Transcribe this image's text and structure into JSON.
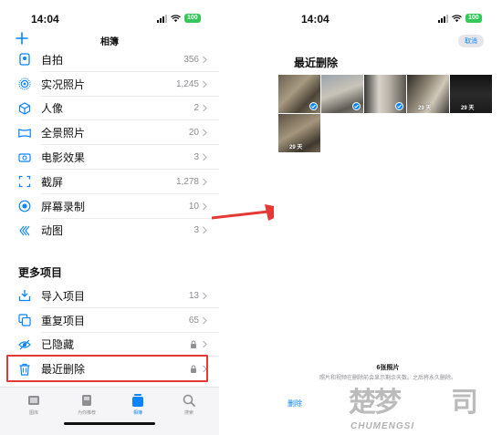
{
  "colors": {
    "accent": "#0a84ff",
    "highlight": "#e53935",
    "arrow": "#e53935",
    "battery": "#34c759"
  },
  "left": {
    "status": {
      "time": "14:04",
      "battery": "100"
    },
    "header": {
      "add_icon": "plus-icon",
      "title": "相簿"
    },
    "media_types": [
      {
        "label": "自拍",
        "count": "356",
        "icon": "selfie-icon"
      },
      {
        "label": "实况照片",
        "count": "1,245",
        "icon": "live-photo-icon"
      },
      {
        "label": "人像",
        "count": "2",
        "icon": "portrait-cube-icon"
      },
      {
        "label": "全景照片",
        "count": "20",
        "icon": "panorama-icon"
      },
      {
        "label": "电影效果",
        "count": "3",
        "icon": "cinematic-icon"
      },
      {
        "label": "截屏",
        "count": "1,278",
        "icon": "screenshot-icon"
      },
      {
        "label": "屏幕录制",
        "count": "10",
        "icon": "screen-record-icon"
      },
      {
        "label": "动图",
        "count": "3",
        "icon": "animated-icon"
      }
    ],
    "more_section": {
      "title": "更多项目",
      "items": [
        {
          "label": "导入项目",
          "count": "13",
          "icon": "import-icon",
          "locked": false
        },
        {
          "label": "重复项目",
          "count": "65",
          "icon": "duplicate-icon",
          "locked": false
        },
        {
          "label": "已隐藏",
          "count": "",
          "icon": "hidden-eye-icon",
          "locked": true
        },
        {
          "label": "最近删除",
          "count": "",
          "icon": "trash-icon",
          "locked": true
        }
      ]
    },
    "tabs": [
      {
        "label": "图库",
        "icon": "library-icon",
        "active": false
      },
      {
        "label": "为你推荐",
        "icon": "for-you-icon",
        "active": false
      },
      {
        "label": "相簿",
        "icon": "albums-icon",
        "active": true
      },
      {
        "label": "搜索",
        "icon": "search-icon",
        "active": false
      }
    ]
  },
  "right": {
    "status": {
      "time": "14:04",
      "battery": "100"
    },
    "cancel_label": "取消",
    "title": "最近删除",
    "photos": [
      {
        "selected": true,
        "days": ""
      },
      {
        "selected": true,
        "days": ""
      },
      {
        "selected": true,
        "days": ""
      },
      {
        "selected": false,
        "days": "29 天"
      },
      {
        "selected": false,
        "days": "29 天"
      },
      {
        "selected": false,
        "days": "29 天"
      }
    ],
    "footer": {
      "count": "6张照片",
      "note": "照片和视频在删除前会显示剩余天数。之后将永久删除。"
    },
    "delete_label": "删除"
  },
  "watermark": {
    "logo": "楚梦",
    "logo2": "司",
    "text": "CHUMENGSI"
  }
}
